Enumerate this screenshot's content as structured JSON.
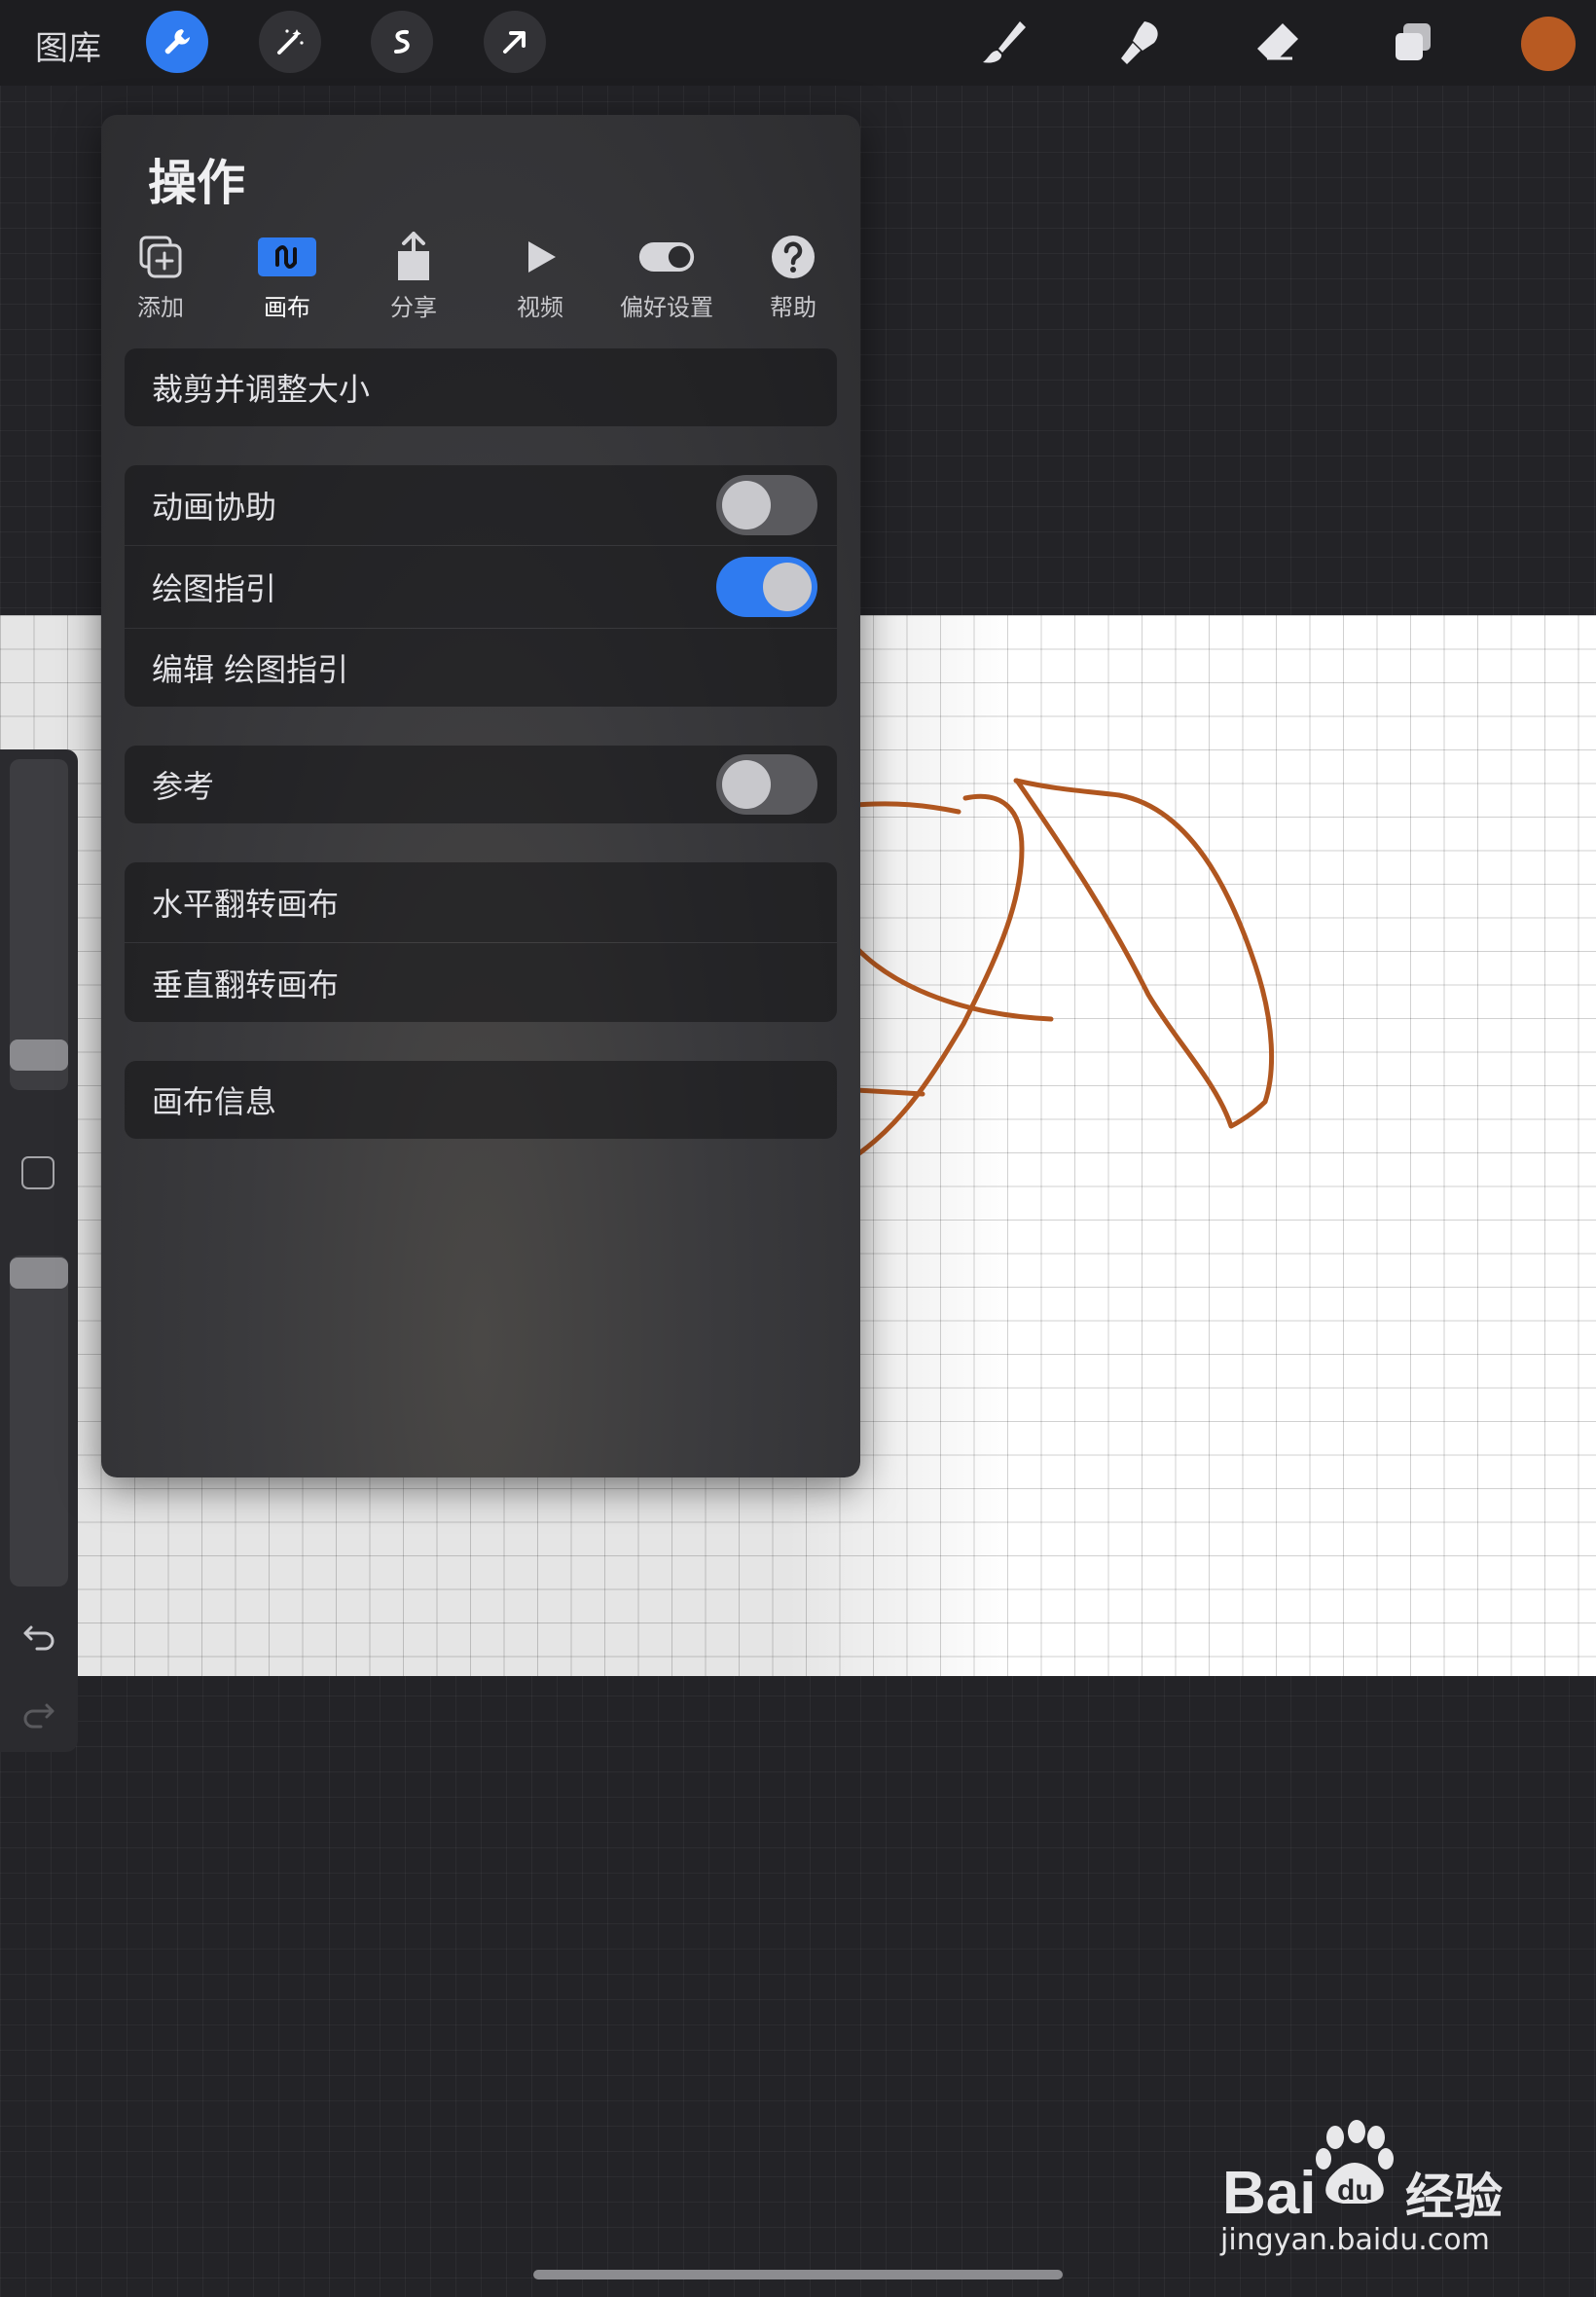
{
  "topbar": {
    "gallery_label": "图库",
    "tools_left": [
      "wrench-icon",
      "magic-wand-icon",
      "selection-icon",
      "transform-arrow-icon"
    ],
    "tools_right": [
      "brush-icon",
      "smudge-icon",
      "eraser-icon",
      "layers-icon"
    ],
    "active_color": "#b85a22",
    "accent": "#2f7bf0"
  },
  "panel": {
    "title": "操作",
    "tabs": [
      {
        "label": "添加",
        "icon": "add-icon"
      },
      {
        "label": "画布",
        "icon": "canvas-icon",
        "active": true
      },
      {
        "label": "分享",
        "icon": "share-icon"
      },
      {
        "label": "视频",
        "icon": "play-icon"
      },
      {
        "label": "偏好设置",
        "icon": "toggle-pref-icon"
      },
      {
        "label": "帮助",
        "icon": "help-icon"
      }
    ],
    "rows": {
      "crop_resize": "裁剪并调整大小",
      "animation_assist": {
        "label": "动画协助",
        "on": false
      },
      "drawing_guide": {
        "label": "绘图指引",
        "on": true
      },
      "edit_drawing_guide": "编辑 绘图指引",
      "reference": {
        "label": "参考",
        "on": false
      },
      "flip_horizontal": "水平翻转画布",
      "flip_vertical": "垂直翻转画布",
      "canvas_info": "画布信息"
    }
  },
  "watermark": {
    "brand": "Bai 经验",
    "url": "jingyan.baidu.com"
  }
}
